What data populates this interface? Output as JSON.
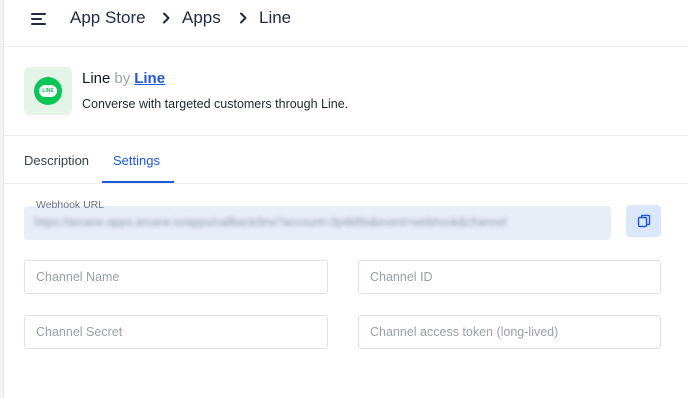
{
  "header": {
    "breadcrumb": [
      "App Store",
      "Apps",
      "Line"
    ]
  },
  "app": {
    "name": "Line",
    "by_label": "by",
    "publisher": "Line",
    "logo_text": "LINE",
    "description": "Converse with targeted customers through Line.",
    "logo_color": "#06c755"
  },
  "tabs": [
    {
      "label": "Description",
      "active": false
    },
    {
      "label": "Settings",
      "active": true
    }
  ],
  "settings": {
    "webhook": {
      "label": "Webhook URL",
      "value": "https://arcane-apps.arcane.io/apps/callback/line?account=3p4kl9s&event=webhook&channel"
    },
    "fields": {
      "channel_name": {
        "placeholder": "Channel Name"
      },
      "channel_id": {
        "placeholder": "Channel ID"
      },
      "channel_secret": {
        "placeholder": "Channel Secret"
      },
      "access_token": {
        "placeholder": "Channel access token (long-lived)"
      }
    }
  },
  "colors": {
    "accent": "#1f5ad6",
    "text_dark": "#1f2a44"
  }
}
